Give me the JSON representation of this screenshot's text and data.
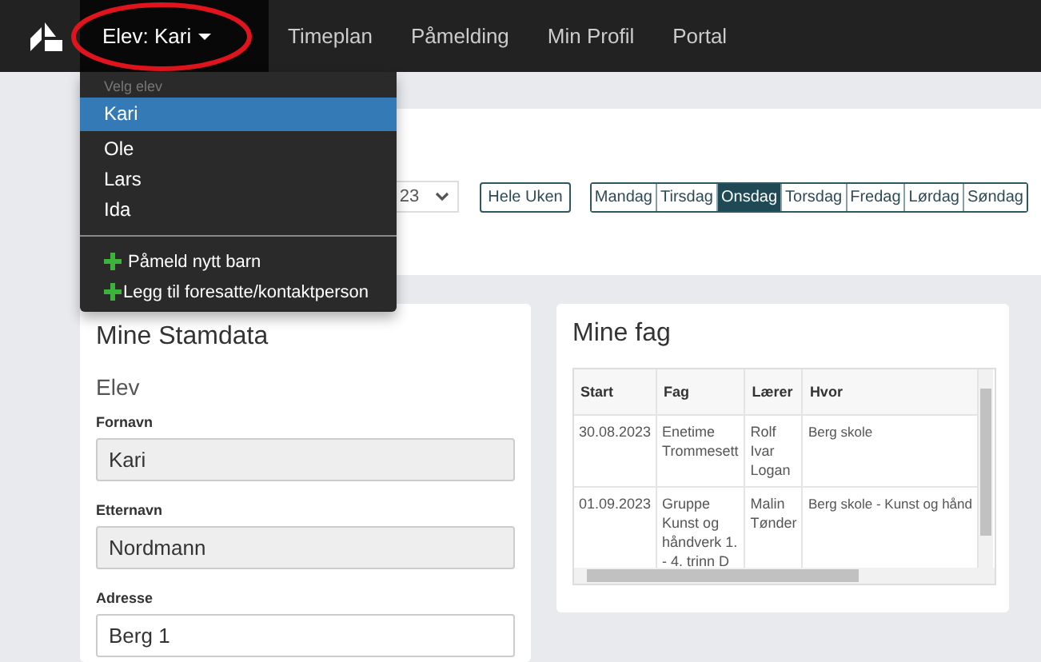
{
  "navbar": {
    "student_menu": {
      "label": "Elev: Kari",
      "expanded": true,
      "highlighted": true
    },
    "items": [
      {
        "label": "Timeplan"
      },
      {
        "label": "Påmelding"
      },
      {
        "label": "Min Profil"
      },
      {
        "label": "Portal"
      }
    ]
  },
  "student_dropdown": {
    "header": "Velg elev",
    "students": [
      {
        "label": "Kari",
        "selected": true
      },
      {
        "label": "Ole",
        "selected": false
      },
      {
        "label": "Lars",
        "selected": false
      },
      {
        "label": "Ida",
        "selected": false
      }
    ],
    "actions": [
      {
        "label": "Påmeld nytt barn"
      },
      {
        "label": "Legg til foresatte/kontaktperson"
      }
    ]
  },
  "schedule_controls": {
    "date_select": {
      "value": "23"
    },
    "whole_week_button": "Hele Uken",
    "days": [
      {
        "label": "Mandag",
        "selected": false
      },
      {
        "label": "Tirsdag",
        "selected": false
      },
      {
        "label": "Onsdag",
        "selected": true
      },
      {
        "label": "Torsdag",
        "selected": false
      },
      {
        "label": "Fredag",
        "selected": false
      },
      {
        "label": "Lørdag",
        "selected": false
      },
      {
        "label": "Søndag",
        "selected": false
      }
    ]
  },
  "master_data": {
    "title": "Mine Stamdata",
    "section": "Elev",
    "fields": [
      {
        "label": "Fornavn",
        "value": "Kari",
        "disabled": true
      },
      {
        "label": "Etternavn",
        "value": "Nordmann",
        "disabled": true
      },
      {
        "label": "Adresse",
        "value": "Berg 1",
        "disabled": false
      }
    ]
  },
  "subjects": {
    "title": "Mine fag",
    "table": {
      "columns": [
        "Start",
        "Fag",
        "Lærer",
        "Hvor"
      ],
      "rows": [
        [
          "30.08.2023",
          "Enetime Trommesett",
          "Rolf Ivar Logan",
          "Berg skole"
        ],
        [
          "01.09.2023",
          "Gruppe Kunst og håndverk 1. - 4. trinn D",
          "Malin Tønder",
          "Berg skole - Kunst og hånd"
        ]
      ]
    }
  }
}
